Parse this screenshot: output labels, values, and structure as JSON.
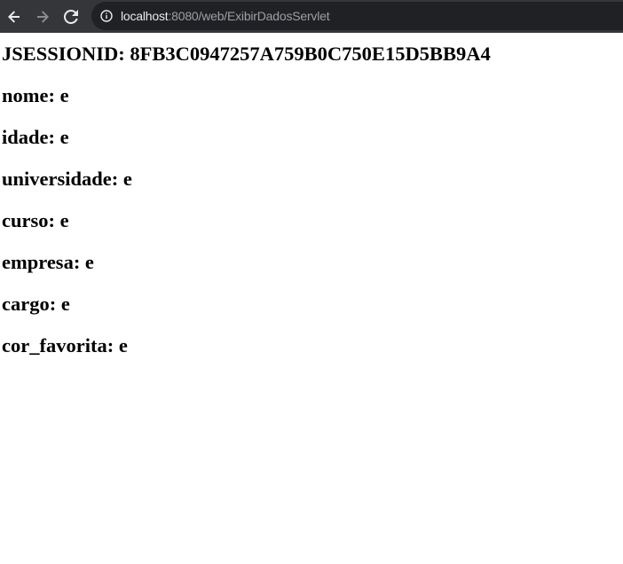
{
  "browser": {
    "url_host": "localhost",
    "url_rest": ":8080/web/ExibirDadosServlet",
    "icons": {
      "back": "arrow-left-icon",
      "forward": "arrow-right-icon",
      "reload": "reload-icon",
      "site_info": "info-circle-icon"
    },
    "colors": {
      "toolbar": "#35363a",
      "omnibox": "#202124"
    }
  },
  "page": {
    "lines": [
      "JSESSIONID: 8FB3C0947257A759B0C750E15D5BB9A4",
      "nome: e",
      "idade: e",
      "universidade: e",
      "curso: e",
      "empresa: e",
      "cargo: e",
      "cor_favorita: e"
    ]
  }
}
